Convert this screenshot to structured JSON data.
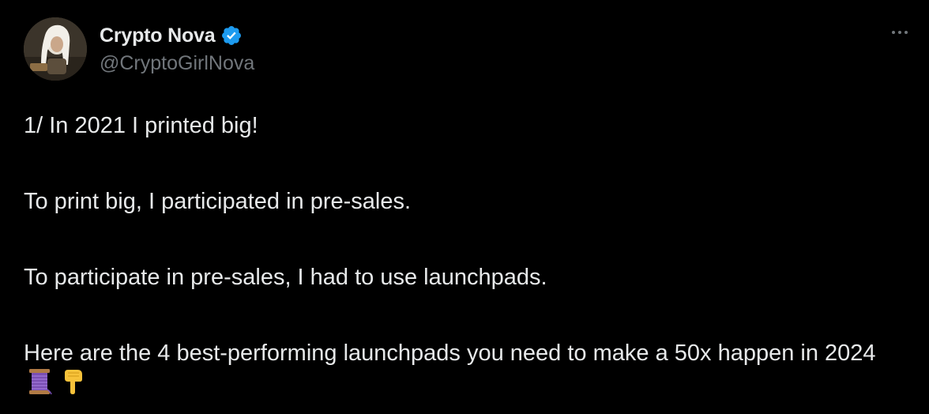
{
  "author": {
    "display_name": "Crypto Nova",
    "handle": "@CryptoGirlNova",
    "verified": true,
    "verified_color": "#1d9bf0"
  },
  "tweet": {
    "paragraphs": [
      "1/ In 2021 I printed big!",
      "To print big, I participated in pre-sales.",
      "To participate in pre-sales, I had to use launchpads.",
      "Here are the 4 best-performing launchpads you need to make a 50x happen in 2024"
    ],
    "emojis": [
      "thread-spool-emoji",
      "pointing-down-emoji"
    ]
  },
  "icons": {
    "verified": "verified-badge-icon",
    "more": "more-options-icon"
  },
  "colors": {
    "background": "#000000",
    "text_primary": "#e7e9ea",
    "text_secondary": "#71767b"
  }
}
